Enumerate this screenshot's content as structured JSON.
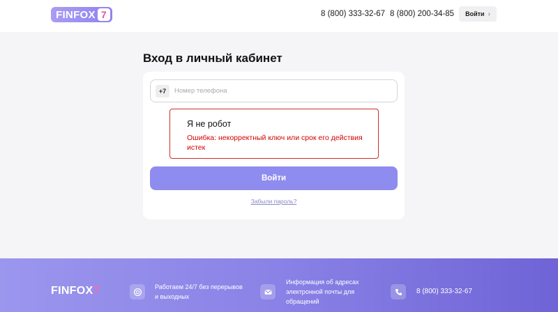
{
  "header": {
    "logo_text": "FINFOX",
    "logo_number": "7",
    "phone1": "8 (800) 333-32-67",
    "phone2": "8 (800) 200-34-85",
    "login_label": "Войти",
    "login_chevron": "›"
  },
  "main": {
    "title": "Вход в личный кабинет",
    "phone_prefix": "+7",
    "phone_placeholder": "Номер телефона",
    "phone_value": "",
    "captcha_title": "Я не робот",
    "captcha_error": "Ошибка: некорректный ключ или срок его действия истек",
    "submit_label": "Войти",
    "forgot_label": "Забыли пароль?"
  },
  "footer": {
    "logo_text": "FINFOX",
    "logo_number": "7",
    "item1_text": "Работаем 24/7 без перерывов и выходных",
    "item2_text": "Информация об адресах электронной почты для обращений",
    "item3_text": "8 (800) 333-32-67",
    "icons": [
      "clock-icon",
      "mail-icon",
      "phone-icon"
    ]
  },
  "colors": {
    "accent": "#8f8cef",
    "error": "#d40000",
    "logo_seven": "#f36bb6"
  }
}
